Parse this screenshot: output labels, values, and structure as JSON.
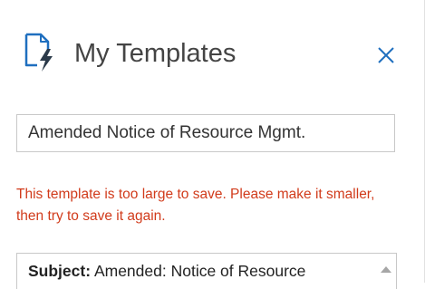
{
  "header": {
    "icon": "document-lightning-icon",
    "title": "My Templates",
    "close_icon": "close-icon"
  },
  "template_name": {
    "value": "Amended Notice of Resource Mgmt."
  },
  "error": {
    "text": "This template is too large to save. Please make it smaller, then try to save it again.",
    "color": "#d13b1b"
  },
  "body": {
    "subject_label": "Subject:",
    "subject_value": "Amended: Notice of Resource",
    "scroll_icon": "scroll-up-arrow-icon"
  },
  "colors": {
    "accent": "#1f6fbf",
    "text": "#444444"
  }
}
